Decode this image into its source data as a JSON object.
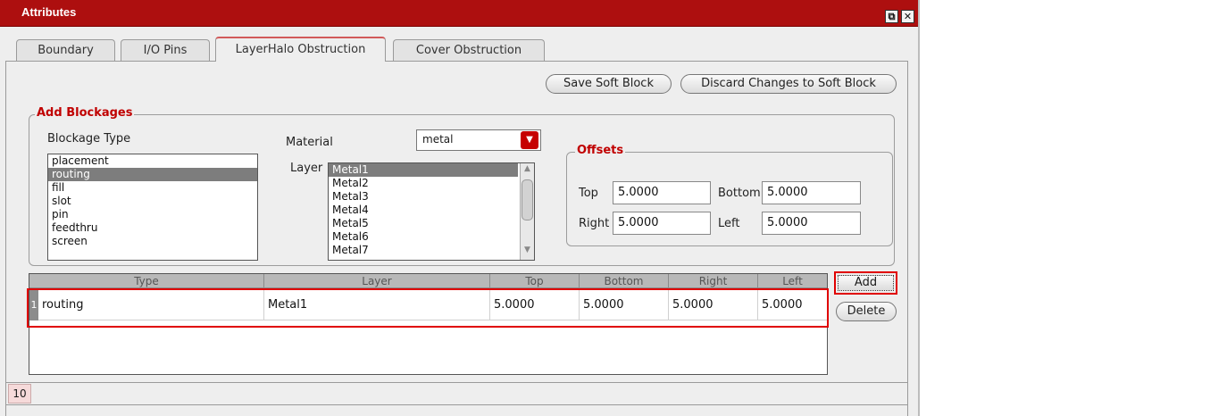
{
  "window": {
    "title": "Attributes"
  },
  "tabs": [
    {
      "label": "Boundary"
    },
    {
      "label": "I/O Pins"
    },
    {
      "label": "LayerHalo Obstruction"
    },
    {
      "label": "Cover Obstruction"
    }
  ],
  "actions": {
    "save": "Save Soft Block",
    "discard": "Discard Changes to Soft Block"
  },
  "add_blockages": {
    "legend": "Add Blockages",
    "blockage_type_label": "Blockage Type",
    "blockage_types": [
      "placement",
      "routing",
      "fill",
      "slot",
      "pin",
      "feedthru",
      "screen"
    ],
    "selected_type": "routing",
    "material_label": "Material",
    "material_value": "metal",
    "layer_label": "Layer",
    "layers": [
      "Metal1",
      "Metal2",
      "Metal3",
      "Metal4",
      "Metal5",
      "Metal6",
      "Metal7"
    ],
    "selected_layer": "Metal1"
  },
  "offsets": {
    "legend": "Offsets",
    "top_label": "Top",
    "top": "5.0000",
    "bottom_label": "Bottom",
    "bottom": "5.0000",
    "right_label": "Right",
    "right": "5.0000",
    "left_label": "Left",
    "left": "5.0000"
  },
  "table": {
    "columns": [
      "Type",
      "Layer",
      "Top",
      "Bottom",
      "Right",
      "Left"
    ],
    "rows": [
      {
        "index": "1",
        "type": "routing",
        "layer": "Metal1",
        "top": "5.0000",
        "bottom": "5.0000",
        "right": "5.0000",
        "left": "5.0000"
      }
    ]
  },
  "table_buttons": {
    "add": "Add",
    "delete": "Delete"
  },
  "status": {
    "number": "10"
  },
  "colors": {
    "titlebar": "#ad0f0f",
    "accent_red": "#e00000",
    "selection": "#7d7d7d"
  }
}
